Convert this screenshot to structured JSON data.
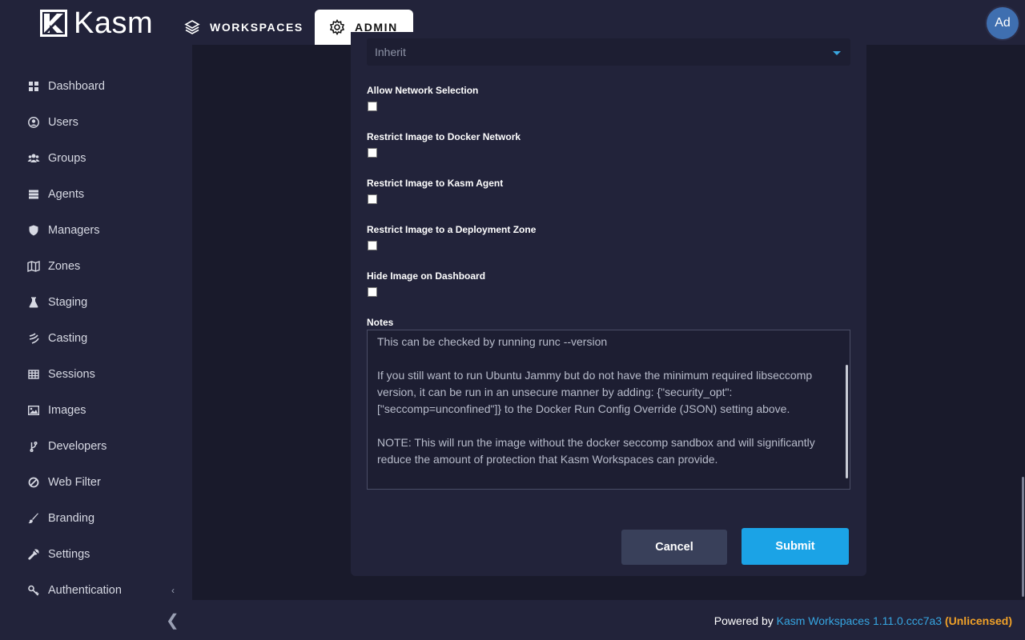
{
  "app": {
    "brand": "Kasm",
    "avatar_initials": "Ad"
  },
  "nav": {
    "workspaces": "WORKSPACES",
    "admin": "ADMIN"
  },
  "sidebar": {
    "items": [
      {
        "label": "Dashboard",
        "icon": "dashboard-icon"
      },
      {
        "label": "Users",
        "icon": "user-circle-icon"
      },
      {
        "label": "Groups",
        "icon": "groups-icon"
      },
      {
        "label": "Agents",
        "icon": "server-icon"
      },
      {
        "label": "Managers",
        "icon": "shield-icon"
      },
      {
        "label": "Zones",
        "icon": "map-icon"
      },
      {
        "label": "Staging",
        "icon": "flask-icon"
      },
      {
        "label": "Casting",
        "icon": "cast-icon"
      },
      {
        "label": "Sessions",
        "icon": "table-icon"
      },
      {
        "label": "Images",
        "icon": "image-icon"
      },
      {
        "label": "Developers",
        "icon": "branch-icon"
      },
      {
        "label": "Web Filter",
        "icon": "ban-icon"
      },
      {
        "label": "Branding",
        "icon": "brush-icon"
      },
      {
        "label": "Settings",
        "icon": "wrench-icon"
      },
      {
        "label": "Authentication",
        "icon": "key-icon"
      }
    ]
  },
  "form": {
    "select_value": "Inherit",
    "fields": [
      {
        "label": "Allow Network Selection",
        "checked": false
      },
      {
        "label": "Restrict Image to Docker Network",
        "checked": false
      },
      {
        "label": "Restrict Image to Kasm Agent",
        "checked": false
      },
      {
        "label": "Restrict Image to a Deployment Zone",
        "checked": false
      },
      {
        "label": "Hide Image on Dashboard",
        "checked": false
      }
    ],
    "notes_label": "Notes",
    "notes_value": "This can be checked by running runc --version\n\nIf you still want to run Ubuntu Jammy but do not have the minimum required libseccomp version, it can be run in an unsecure manner by adding: {\"security_opt\": [\"seccomp=unconfined\"]} to the Docker Run Config Override (JSON) setting above.\n\nNOTE: This will run the image without the docker seccomp sandbox and will significantly reduce the amount of protection that Kasm Workspaces can provide.",
    "cancel_label": "Cancel",
    "submit_label": "Submit"
  },
  "footer": {
    "prefix": "Powered by ",
    "product": "Kasm Workspaces 1.11.0.ccc7a3",
    "license": "(Unlicensed)"
  },
  "colors": {
    "accent": "#1ba3e6",
    "warning": "#f0a128",
    "background": "#191a2b",
    "panel": "#22233a"
  }
}
